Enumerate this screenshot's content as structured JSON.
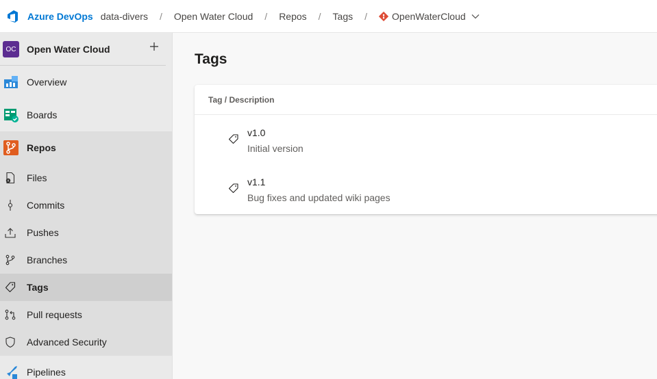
{
  "header": {
    "brand": "Azure DevOps",
    "breadcrumbs": [
      "data-divers",
      "Open Water Cloud",
      "Repos",
      "Tags"
    ],
    "separator": "/",
    "repo": "OpenWaterCloud"
  },
  "sidebar": {
    "project": {
      "initials": "OC",
      "name": "Open Water Cloud",
      "avatar_color": "#5c2d91"
    },
    "main_items": [
      {
        "label": "Overview",
        "icon": "overview-icon"
      },
      {
        "label": "Boards",
        "icon": "boards-icon"
      },
      {
        "label": "Repos",
        "icon": "repos-icon"
      }
    ],
    "repo_items": [
      {
        "label": "Files",
        "icon": "files-icon"
      },
      {
        "label": "Commits",
        "icon": "commits-icon"
      },
      {
        "label": "Pushes",
        "icon": "pushes-icon"
      },
      {
        "label": "Branches",
        "icon": "branches-icon"
      },
      {
        "label": "Tags",
        "icon": "tag-icon",
        "selected": true
      },
      {
        "label": "Pull requests",
        "icon": "pull-request-icon"
      },
      {
        "label": "Advanced Security",
        "icon": "shield-icon"
      }
    ],
    "bottom_items": [
      {
        "label": "Pipelines",
        "icon": "pipelines-icon"
      }
    ]
  },
  "main": {
    "title": "Tags",
    "table": {
      "header": "Tag / Description",
      "rows": [
        {
          "name": "v1.0",
          "description": "Initial version"
        },
        {
          "name": "v1.1",
          "description": "Bug fixes and updated wiki pages"
        }
      ]
    }
  },
  "colors": {
    "accent": "#0078d4",
    "repos_orange": "#e05d1f",
    "git_red": "#de4c36",
    "boards_green": "#009b72",
    "sidebar_bg": "#eaeaea",
    "selected_bg": "#cfcfcf"
  }
}
